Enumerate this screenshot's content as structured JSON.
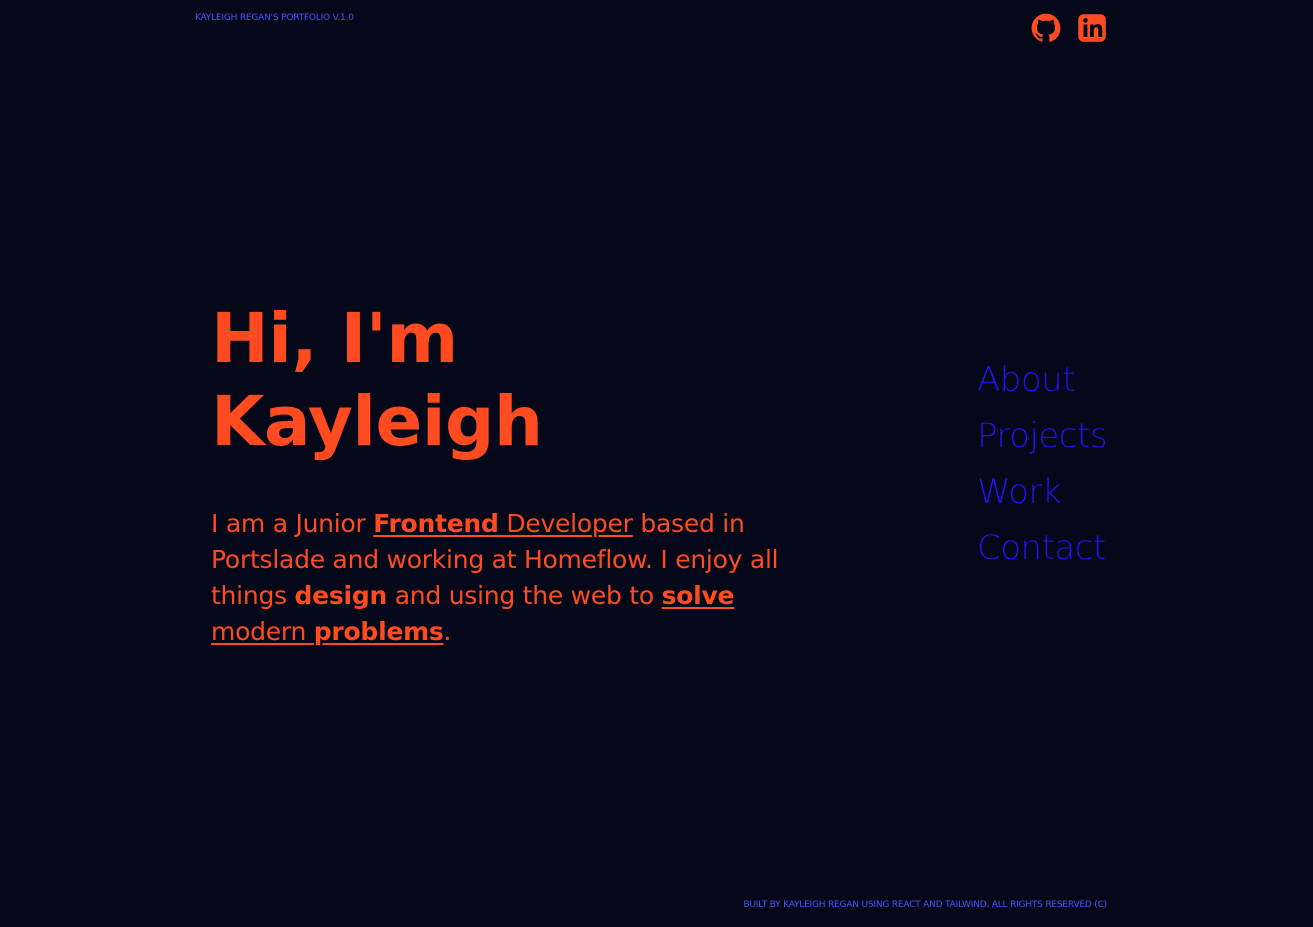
{
  "header": {
    "brand": "KAYLEIGH REGAN'S PORTFOLIO V.1.0",
    "social": [
      {
        "name": "github",
        "icon": "github-icon"
      },
      {
        "name": "linkedin",
        "icon": "linkedin-icon"
      }
    ]
  },
  "hero": {
    "title_line_1": "Hi, I'm",
    "title_line_2": "Kayleigh",
    "intro": {
      "before": "I am a Junior ",
      "link_1_bold": "Frontend",
      "link_1_space": " ",
      "link_1_regular": "Developer",
      "middle_1": " based in Portslade and working at Homeflow. I enjoy all things ",
      "bold_design": "design",
      "middle_2": " and using the web to ",
      "link_2_bold_1": "solve",
      "link_2_regular": " modern ",
      "link_2_bold_2": "problems",
      "ending": "."
    }
  },
  "navigation": {
    "items": [
      "About",
      "Projects",
      "Work",
      "Contact"
    ]
  },
  "footer": {
    "text": "BUILT BY KAYLEIGH REGAN USING REACT AND TAILWIND. ALL RIGHTS RESERVED (C)"
  },
  "colors": {
    "background": "#050818",
    "accent_orange": "#ff4b1f",
    "nav_blue": "#2b10ff",
    "small_text_blue": "#4b52ff"
  }
}
